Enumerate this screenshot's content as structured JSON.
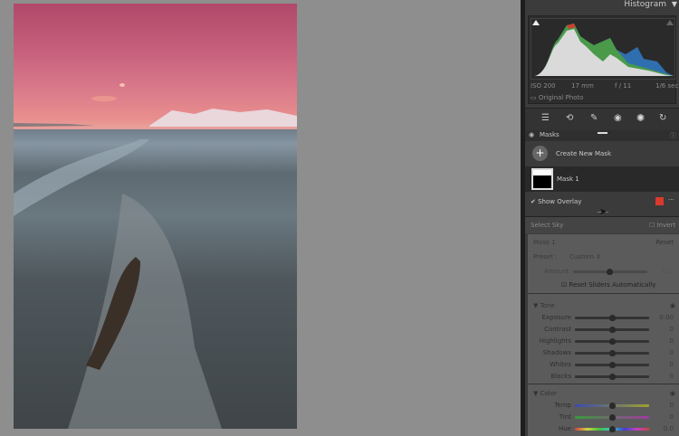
{
  "histogram": {
    "title": "Histogram",
    "iso": "ISO 200",
    "focal": "17 mm",
    "aperture": "f / 11",
    "shutter": "1/6 sec",
    "original_photo": "Original Photo"
  },
  "tools": [
    "edit-icon",
    "crop-icon",
    "heal-icon",
    "redeye-icon",
    "masking-icon",
    "presets-icon"
  ],
  "masks": {
    "title": "Masks",
    "create_label": "Create New Mask",
    "mask_name": "Mask 1",
    "show_overlay": "Show Overlay",
    "overlay_color": "#d93a2b",
    "selection": "Select Sky",
    "invert": "Invert"
  },
  "mask_panel": {
    "title": "Mask 1",
    "reset": "Reset",
    "preset_label": "Preset :",
    "preset_value": "Custom",
    "amount_label": "Amount",
    "amount_value": "100",
    "reset_sliders": "Reset Sliders Automatically"
  },
  "tone": {
    "title": "Tone",
    "sliders": [
      {
        "label": "Exposure",
        "value": "0.00"
      },
      {
        "label": "Contrast",
        "value": "0"
      },
      {
        "label": "Highlights",
        "value": "0"
      },
      {
        "label": "Shadows",
        "value": "0"
      },
      {
        "label": "Whites",
        "value": "0"
      },
      {
        "label": "Blacks",
        "value": "0"
      }
    ]
  },
  "color": {
    "title": "Color",
    "sliders": [
      {
        "label": "Temp",
        "value": "0"
      },
      {
        "label": "Tint",
        "value": "0"
      },
      {
        "label": "Hue",
        "value": "0.0"
      }
    ]
  }
}
